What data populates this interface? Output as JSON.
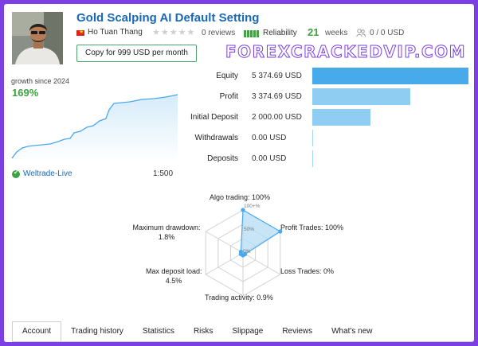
{
  "header": {
    "title": "Gold Scalping AI Default Setting",
    "author": "Ho Tuan Thang",
    "reviews": "0 reviews",
    "reliability": "Reliability",
    "weeks_value": "21",
    "weeks_label": "weeks",
    "subscribers": "0 / 0 USD",
    "copy_button": "Copy for 999 USD per month",
    "rating_stars": 0,
    "reliability_bars": 5
  },
  "watermark": "FOREXCRACKEDVIP.COM",
  "growth": {
    "label": "growth since 2024",
    "value": "169%"
  },
  "account": {
    "server": "Weltrade-Live",
    "leverage": "1:500"
  },
  "balances": [
    {
      "label": "Equity",
      "value": "5 374.69 USD",
      "amount": 5374.69
    },
    {
      "label": "Profit",
      "value": "3 374.69 USD",
      "amount": 3374.69
    },
    {
      "label": "Initial Deposit",
      "value": "2 000.00 USD",
      "amount": 2000.0
    },
    {
      "label": "Withdrawals",
      "value": "0.00 USD",
      "amount": 0
    },
    {
      "label": "Deposits",
      "value": "0.00 USD",
      "amount": 0
    }
  ],
  "radar": {
    "algo_trading": "Algo trading: 100%",
    "profit_trades": "Profit Trades: 100%",
    "loss_trades": "Loss Trades: 0%",
    "trading_activity": "Trading activity: 0.9%",
    "max_deposit_load_label": "Max deposit load:",
    "max_deposit_load_value": "4.5%",
    "max_drawdown_label": "Maximum drawdown:",
    "max_drawdown_value": "1.8%",
    "ticks": [
      "100+%",
      "50%",
      "0%"
    ],
    "values": {
      "algo_trading": 100,
      "profit_trades": 100,
      "loss_trades": 0,
      "trading_activity": 0.9,
      "max_deposit_load": 4.5,
      "max_drawdown": 1.8
    }
  },
  "tabs": [
    "Account",
    "Trading history",
    "Statistics",
    "Risks",
    "Slippage",
    "Reviews",
    "What's new"
  ],
  "active_tab": "Account",
  "colors": {
    "frame": "#7b3fe4",
    "link": "#1a68b8",
    "positive": "#3ea33e",
    "bar_primary": "#47aaea",
    "bar_secondary": "#8fcdf3",
    "radar_fill": "#b6dcf5",
    "radar_line": "#4aa8ee"
  }
}
